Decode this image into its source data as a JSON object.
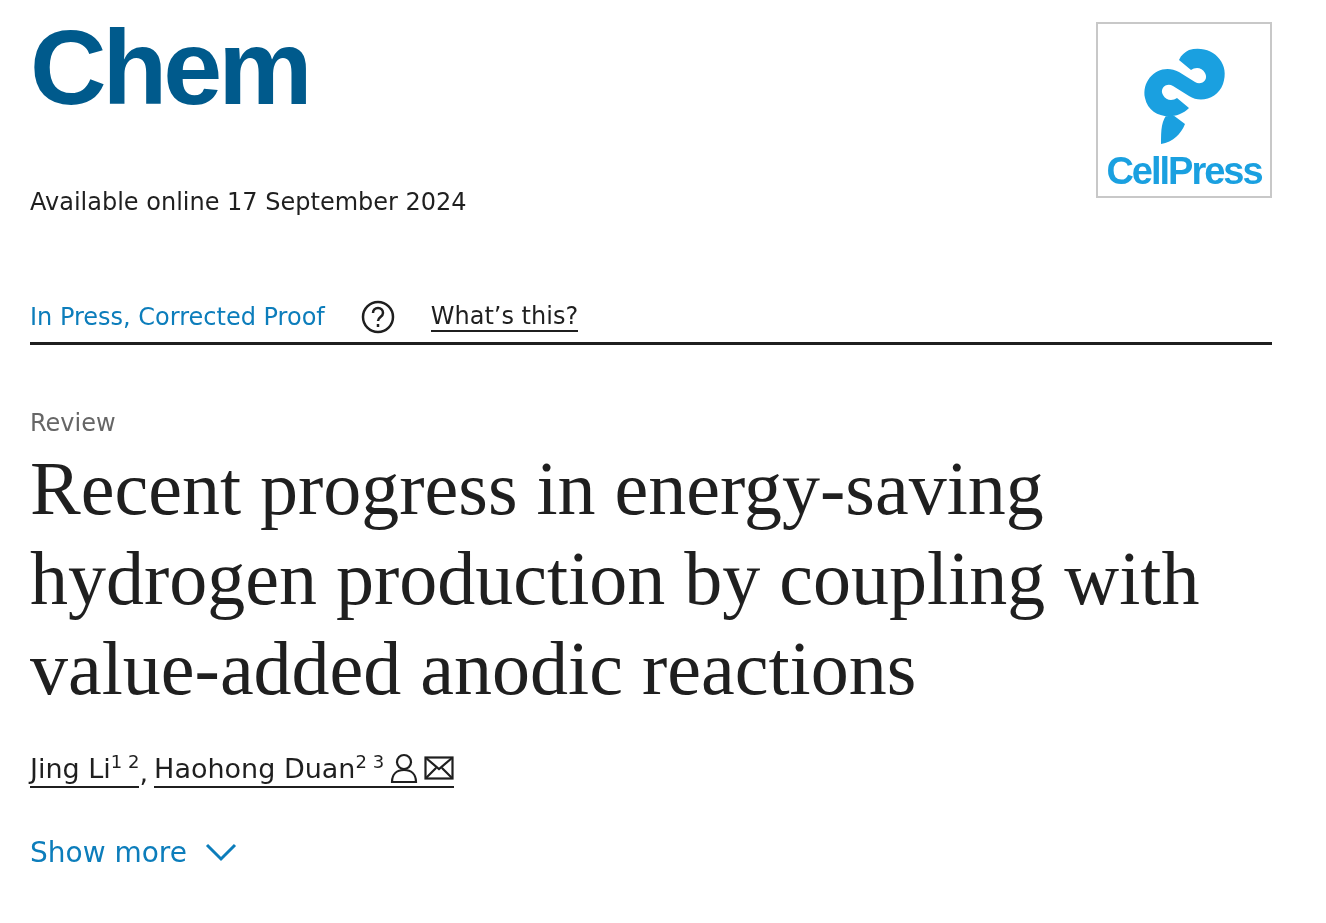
{
  "journal": {
    "name": "Chem"
  },
  "publisher_logo": {
    "text": "CellPress"
  },
  "availability": "Available online 17 September 2024",
  "status": {
    "label": "In Press, Corrected Proof",
    "help_link": "What’s this?"
  },
  "article_type": "Review",
  "title": "Recent progress in energy-saving hydrogen production by coupling with value-added anodic reactions",
  "authors": [
    {
      "name": "Jing Li",
      "affiliations": "1 2",
      "corresponding": false,
      "email": false
    },
    {
      "name": "Haohong Duan",
      "affiliations": "2 3",
      "corresponding": true,
      "email": true
    }
  ],
  "author_separator": ",",
  "show_more": {
    "label": "Show more",
    "expanded": false
  }
}
